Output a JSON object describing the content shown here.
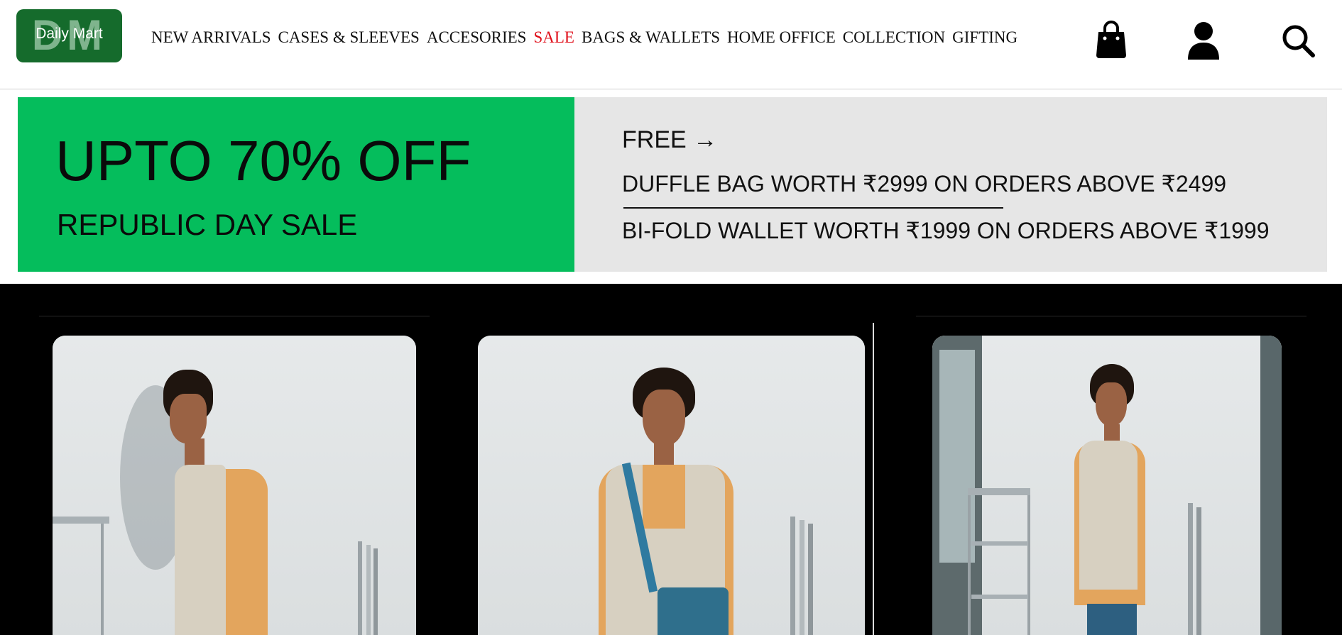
{
  "brand": {
    "logo_mark": "DM",
    "logo_text": "Daily Mart",
    "primary_color": "#156b2c"
  },
  "nav": {
    "items": [
      {
        "label": "NEW ARRIVALS"
      },
      {
        "label": "CASES & SLEEVES"
      },
      {
        "label": "ACCESORIES"
      },
      {
        "label": "SALE",
        "highlight_color": "#e0101b"
      },
      {
        "label": "BAGS & WALLETS"
      },
      {
        "label": "HOME OFFICE"
      },
      {
        "label": "COLLECTION"
      },
      {
        "label": "GIFTING"
      }
    ]
  },
  "header_icons": [
    "shopping-bag-icon",
    "user-account-icon",
    "search-icon"
  ],
  "banner": {
    "headline": "UPTO 70% OFF",
    "subheadline": "REPUBLIC DAY SALE",
    "offer_title": "FREE →",
    "offers": [
      "DUFFLE BAG WORTH ₹2999 ON ORDERS ABOVE ₹2499",
      "BI-FOLD WALLET WORTH ₹1999 ON ORDERS ABOVE ₹1999"
    ],
    "left_color": "#05bd5c",
    "right_color": "#e6e6e6"
  },
  "hero": {
    "background_color": "#000000",
    "frames": [
      "model-side-view-photo",
      "model-front-view-photo",
      "model-three-quarter-photo"
    ]
  }
}
